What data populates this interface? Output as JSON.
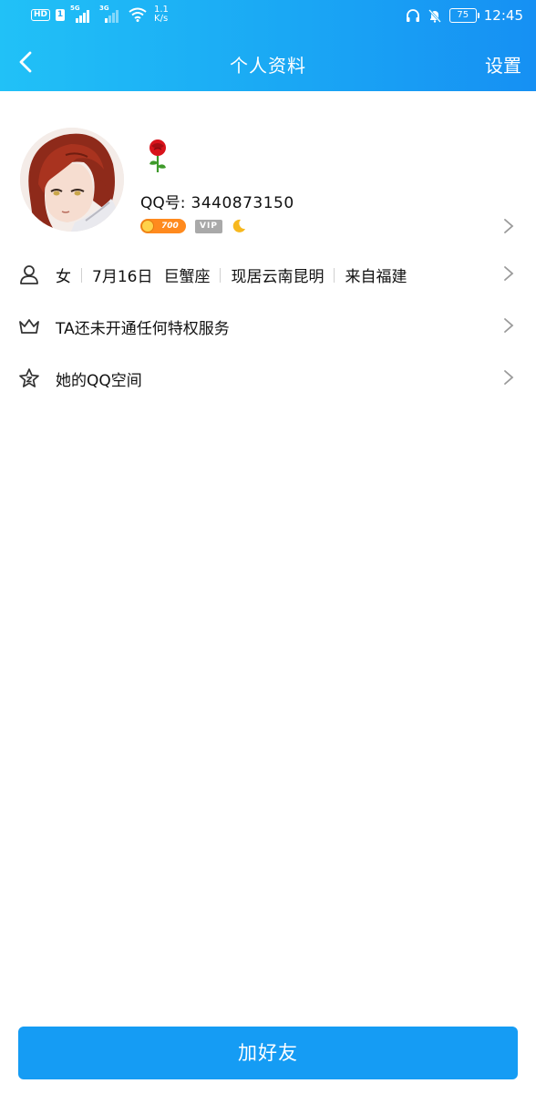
{
  "status_bar": {
    "hd_label": "HD",
    "sim_label": "1",
    "net1": "5G",
    "net2": "3G",
    "speed_value": "1.1",
    "speed_unit": "K/s",
    "battery": "75",
    "time": "12:45"
  },
  "nav": {
    "title": "个人资料",
    "settings_label": "设置"
  },
  "profile": {
    "qq_label": "QQ号:",
    "qq_number": "3440873150",
    "coin_value": "700",
    "vip_label": "VIP"
  },
  "info_row": {
    "gender": "女",
    "birthday": "7月16日",
    "zodiac": "巨蟹座",
    "location": "现居云南昆明",
    "hometown": "来自福建"
  },
  "privilege_row": {
    "label": "TA还未开通任何特权服务"
  },
  "qzone_row": {
    "label": "她的QQ空间"
  },
  "add_friend_label": "加好友",
  "colors": {
    "header_gradient_start": "#21c1f7",
    "header_gradient_end": "#1690f3",
    "primary_button": "#159cf4",
    "coin_badge": "#ff8a1e",
    "vip_badge": "#a9a9a9"
  },
  "icons": [
    "back-arrow-icon",
    "rose-icon",
    "coin-icon",
    "moon-icon",
    "person-icon",
    "crown-icon",
    "star-icon",
    "chevron-right-icon",
    "headphones-icon",
    "bell-muted-icon",
    "wifi-icon"
  ]
}
